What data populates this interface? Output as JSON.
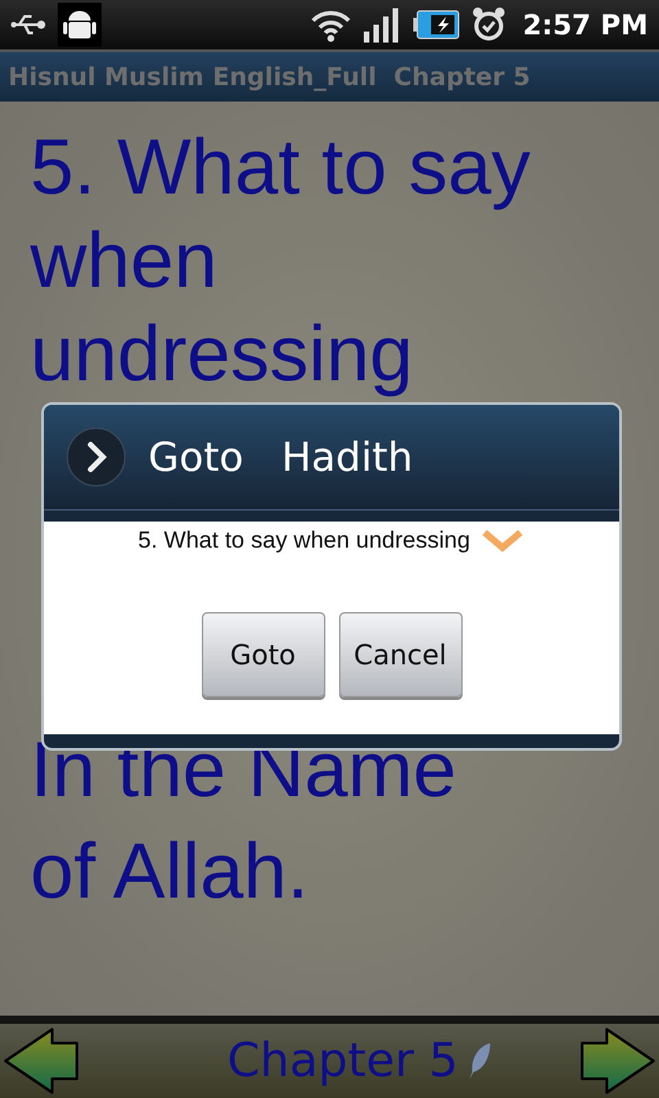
{
  "status_bar": {
    "time": "2:57 PM"
  },
  "title_bar": {
    "title": "Hisnul Muslim English_Full  Chapter 5"
  },
  "content": {
    "lines": [
      "5. What to say",
      "when",
      "undressing"
    ],
    "lines_after": [
      "In the Name",
      "of Allah."
    ]
  },
  "dialog": {
    "title": "Goto   Hadith",
    "selection": "5. What to say when undressing",
    "buttons": [
      "Goto",
      "Cancel"
    ]
  },
  "bottom_bar": {
    "chapter": "Chapter 5"
  }
}
